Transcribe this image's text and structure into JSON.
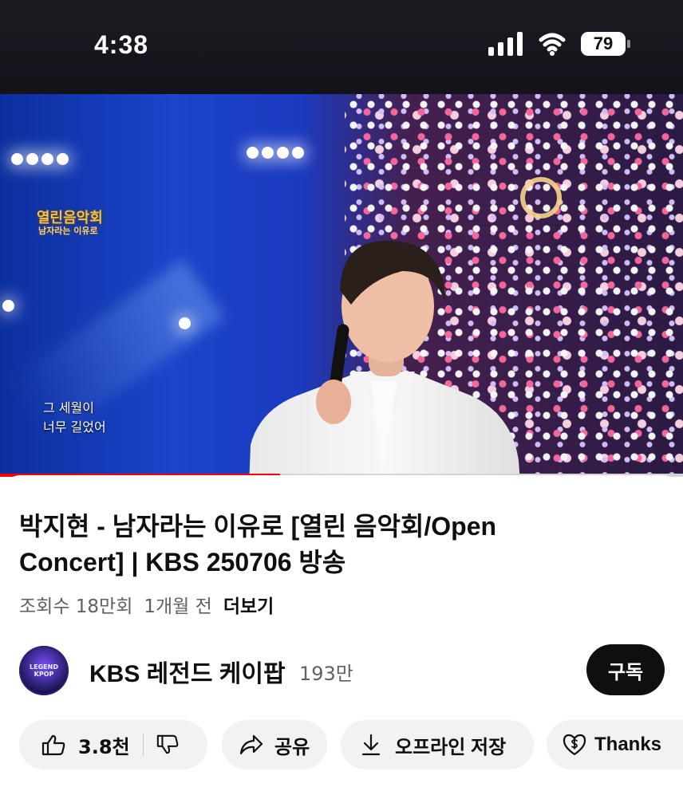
{
  "status_bar": {
    "time": "4:38",
    "battery": "79",
    "icons": [
      "signal-icon",
      "wifi-icon",
      "battery-icon"
    ]
  },
  "video": {
    "overlay_logo": "열린음악회",
    "overlay_subtext": "남자라는 이유로",
    "subtitle_lines": [
      "그 세월이",
      "너무 길었어"
    ],
    "progress": 0.41
  },
  "details": {
    "title": "박지현 - 남자라는 이유로 [열린 음악회/Open Concert] | KBS 250706 방송",
    "views": "조회수 18만회",
    "time_ago": "1개월 전",
    "more": "더보기"
  },
  "channel": {
    "name": "KBS 레전드 케이팝",
    "subscribers": "193만",
    "avatar_text": [
      "LEGEND",
      "KPOP"
    ],
    "subscribe_label": "구독"
  },
  "actions": {
    "like_count": "3.8천",
    "share_label": "공유",
    "download_label": "오프라인 저장",
    "thanks_label": "Thanks"
  },
  "colors": {
    "accent": "#ff0000",
    "text_primary": "#0f0f0f",
    "text_secondary": "#606060",
    "pill_bg": "#f2f2f2"
  }
}
